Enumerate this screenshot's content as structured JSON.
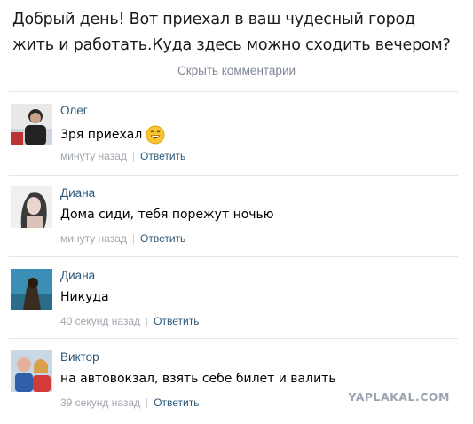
{
  "post": {
    "line1": "Добрый день! Вот приехал в ваш чудесный город",
    "line2": "жить и работать.Куда здесь можно сходить вечером?"
  },
  "hide_comments_label": "Скрыть комментарии",
  "comments": [
    {
      "author": "Олег",
      "text": "Зря приехал",
      "emoji": "smile-emoji",
      "time": "минуту назад",
      "reply": "Ответить"
    },
    {
      "author": "Диана",
      "text": "Дома сиди, тебя порежут ночью",
      "time": "минуту назад",
      "reply": "Ответить"
    },
    {
      "author": "Диана",
      "text": "Никуда",
      "time": "40 секунд назад",
      "reply": "Ответить"
    },
    {
      "author": "Виктор",
      "text": "на автовокзал, взять себе билет и валить",
      "time": "39 секунд назад",
      "reply": "Ответить"
    }
  ],
  "meta_separator": "|",
  "watermark": "YAPLAKAL.COM",
  "colors": {
    "author": "#2b587a",
    "reply": "#2b587a",
    "time": "#a1a7ae",
    "hide_comments": "#7d8794",
    "divider": "#e3e6ea"
  }
}
